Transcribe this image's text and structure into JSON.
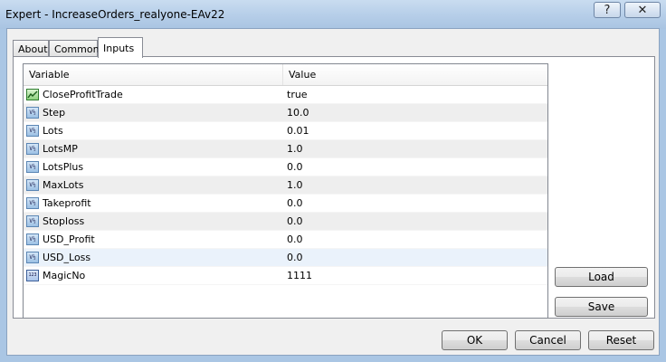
{
  "window": {
    "title": "Expert - IncreaseOrders_realyone-EAv22",
    "help_glyph": "?",
    "close_glyph": "✕"
  },
  "tabs": [
    {
      "label": "About"
    },
    {
      "label": "Common"
    },
    {
      "label": "Inputs"
    }
  ],
  "active_tab": "Inputs",
  "grid": {
    "headers": {
      "variable": "Variable",
      "value": "Value"
    },
    "rows": [
      {
        "name": "CloseProfitTrade",
        "value": "true",
        "type": "bool-icon"
      },
      {
        "name": "Step",
        "value": "10.0",
        "type": "double-icon"
      },
      {
        "name": "Lots",
        "value": "0.01",
        "type": "double-icon"
      },
      {
        "name": "LotsMP",
        "value": "1.0",
        "type": "double-icon"
      },
      {
        "name": "LotsPlus",
        "value": "0.0",
        "type": "double-icon"
      },
      {
        "name": "MaxLots",
        "value": "1.0",
        "type": "double-icon"
      },
      {
        "name": "Takeprofit",
        "value": "0.0",
        "type": "double-icon"
      },
      {
        "name": "Stoploss",
        "value": "0.0",
        "type": "double-icon"
      },
      {
        "name": "USD_Profit",
        "value": "0.0",
        "type": "double-icon"
      },
      {
        "name": "USD_Loss",
        "value": "0.0",
        "type": "double-icon"
      },
      {
        "name": "MagicNo",
        "value": "1111",
        "type": "integer-icon"
      }
    ]
  },
  "side_buttons": {
    "load": "Load",
    "save": "Save"
  },
  "dialog_buttons": {
    "ok": "OK",
    "cancel": "Cancel",
    "reset": "Reset"
  },
  "colors": {
    "selected_row": "#eaf2fb",
    "alt_row": "#eeeeee"
  }
}
